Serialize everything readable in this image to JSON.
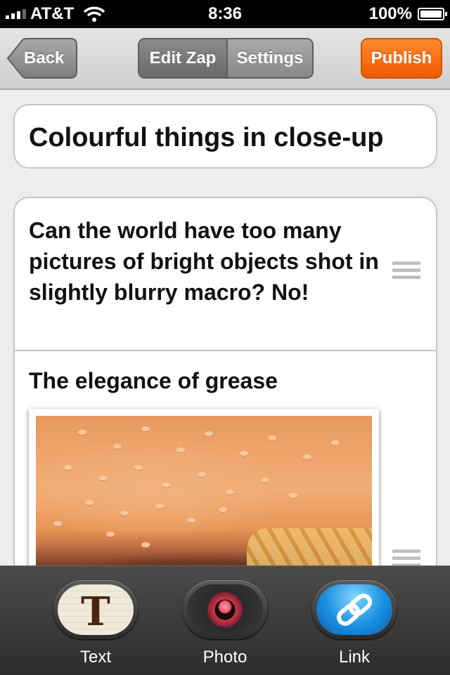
{
  "status_bar": {
    "carrier": "AT&T",
    "time": "8:36",
    "battery": "100%"
  },
  "nav": {
    "back_label": "Back",
    "segments": [
      "Edit Zap",
      "Settings"
    ],
    "publish_label": "Publish",
    "accent_color": "#f26a0a"
  },
  "zap": {
    "title": "Colourful things in close-up",
    "items": [
      {
        "type": "text",
        "text": "Can the world have too many pictures of bright objects shot in slightly blurry macro? No!"
      },
      {
        "type": "photo",
        "caption": "The elegance of grease"
      }
    ]
  },
  "toolbar": {
    "tools": [
      {
        "label": "Text",
        "icon": "text-t-icon"
      },
      {
        "label": "Photo",
        "icon": "camera-lens-icon"
      },
      {
        "label": "Link",
        "icon": "chain-link-icon"
      }
    ]
  }
}
